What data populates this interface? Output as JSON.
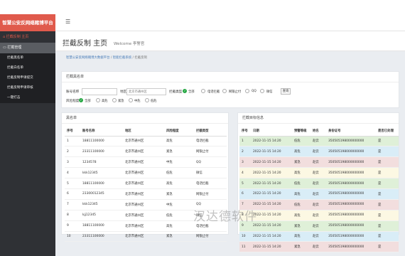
{
  "app": {
    "brand": "智慧公安反网络赌博平台",
    "menu_icon": "hamburger-icon"
  },
  "sidebar": {
    "home": "拦截反制 主页",
    "group": "拦截管理",
    "items": [
      {
        "label": "拦截黑名单"
      },
      {
        "label": "拦截白名单"
      },
      {
        "label": "拦截反制申请提交"
      },
      {
        "label": "拦截反制申请审核"
      },
      {
        "label": "一键打击"
      }
    ]
  },
  "header": {
    "title": "拦截反制 主页",
    "subtitle": "Welcome 李警官"
  },
  "breadcrumb": {
    "items": [
      "智慧公安反网络赌博大数据平台",
      "智能拦截系统",
      "拦截反制"
    ]
  },
  "filter": {
    "title": "拦截黑名单",
    "account_label": "账号名称",
    "area_label": "地区",
    "area_placeholder": "北京市通州区",
    "type_label": "拦截类型",
    "type_options": [
      "全部",
      "电话拦截",
      "网银止付",
      "QQ",
      "微信"
    ],
    "risk_label": "风险程度",
    "risk_options": [
      "全部",
      "高危",
      "紧急",
      "中危",
      "低危"
    ],
    "query_label": "查询"
  },
  "blacklist": {
    "title": "黑名单",
    "columns": [
      "序号",
      "账号名称",
      "地区",
      "风险程度",
      "拦截类型"
    ],
    "rows": [
      [
        "1",
        "18811100000",
        "北京市通州区",
        "高危",
        "电话拦截"
      ],
      [
        "2",
        "23311100000",
        "北京市通州区",
        "紧急",
        "网银止付"
      ],
      [
        "3",
        "1234578",
        "北京市通州区",
        "中危",
        "QQ"
      ],
      [
        "4",
        "kkk12345",
        "北京市通州区",
        "低危",
        "微信"
      ],
      [
        "5",
        "18811100000",
        "北京市通州区",
        "高危",
        "电话拦截"
      ],
      [
        "6",
        "23300012345",
        "北京市通州区",
        "紧急",
        "网银止付"
      ],
      [
        "7",
        "kkk12345",
        "北京市通州区",
        "中危",
        "QQ"
      ],
      [
        "8",
        "kjj12345",
        "北京市通州区",
        "低危",
        "微信"
      ],
      [
        "9",
        "18811100000",
        "北京市通州区",
        "高危",
        "电话拦截"
      ],
      [
        "10",
        "23311100000",
        "北京市通州区",
        "紧急",
        "网银止付"
      ]
    ]
  },
  "intercept": {
    "title": "拦截目标信息",
    "columns": [
      "序号",
      "日期",
      "预警等级",
      "姓名",
      "身份证号",
      "是否已处理"
    ],
    "rows": [
      [
        "1",
        "2022-11-15 14:20",
        "低危",
        "赵云",
        "350505198000000000",
        "是"
      ],
      [
        "2",
        "2022-11-15 14:20",
        "高危",
        "赵云",
        "350505198000000000",
        "是"
      ],
      [
        "3",
        "2022-11-15 14:20",
        "紧急",
        "赵云",
        "350505198000000000",
        "是"
      ],
      [
        "4",
        "2022-11-15 14:20",
        "高危",
        "赵云",
        "350505198000000000",
        "是"
      ],
      [
        "5",
        "2022-11-15 14:20",
        "低危",
        "赵云",
        "350505198000000000",
        "是"
      ],
      [
        "6",
        "2022-11-15 14:20",
        "高危",
        "赵云",
        "350505198000000000",
        "是"
      ],
      [
        "7",
        "2022-11-15 14:20",
        "低危",
        "赵云",
        "350505198000000000",
        "是"
      ],
      [
        "8",
        "2022-11-15 14:20",
        "高危",
        "赵云",
        "350505198000000000",
        "是"
      ],
      [
        "9",
        "2022-11-15 14:20",
        "紧急",
        "赵云",
        "350505198000000000",
        "是"
      ],
      [
        "10",
        "2022-11-15 14:20",
        "高危",
        "赵云",
        "350505198000000000",
        "是"
      ],
      [
        "11",
        "2022-11-15 14:20",
        "紧急",
        "赵云",
        "350505198000000000",
        "是"
      ]
    ]
  },
  "watermark": "汉达德软件"
}
